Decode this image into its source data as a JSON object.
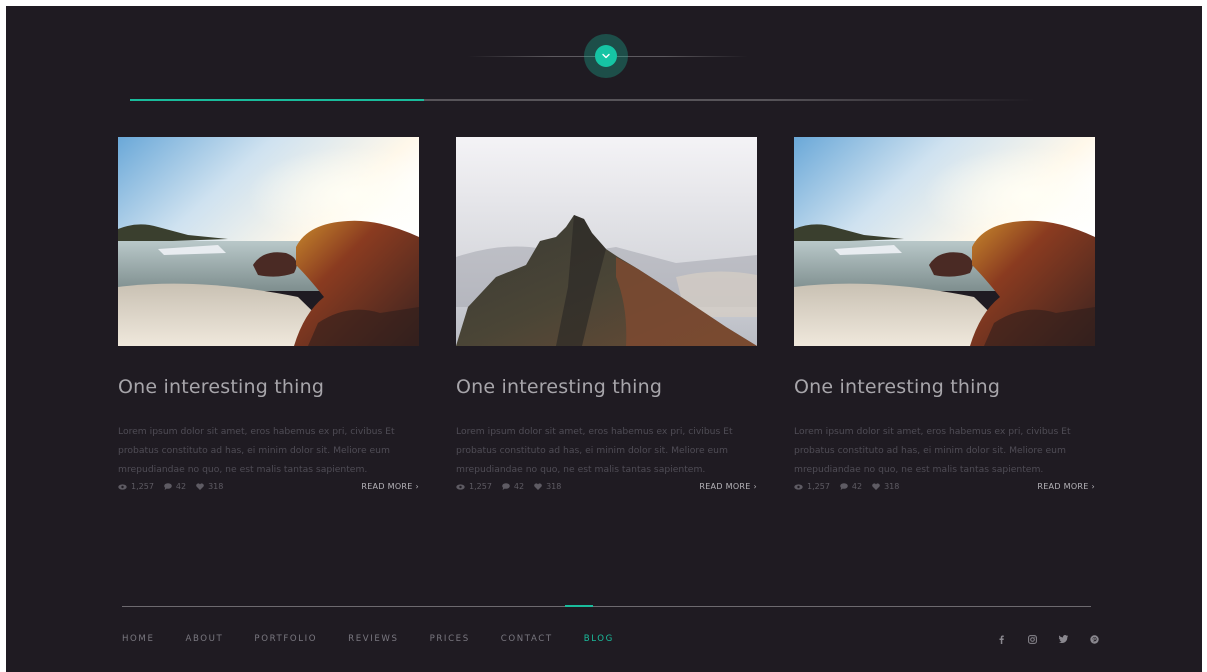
{
  "colors": {
    "background": "#1f1b22",
    "accent": "#1abc9c",
    "title": "#a7a5aa",
    "body_text": "#4f4c55"
  },
  "progress": {
    "fraction": 0.325
  },
  "scroll_button": {
    "icon": "chevron-down-icon"
  },
  "posts": [
    {
      "image": "beach-sunset-image",
      "title": "One interesting thing",
      "excerpt": "Lorem ipsum dolor sit amet, eros habemus ex pri, civibus Et probatus constituto ad has, ei minim dolor sit. Meliore eum mrepudiandae no quo, ne est malis tantas sapientem.",
      "views": "1,257",
      "comments": "42",
      "likes": "318",
      "read_more": "READ MORE ›"
    },
    {
      "image": "mountain-peak-image",
      "title": "One interesting thing",
      "excerpt": "Lorem ipsum dolor sit amet, eros habemus ex pri, civibus Et probatus constituto ad has, ei minim dolor sit. Meliore eum mrepudiandae no quo, ne est malis tantas sapientem.",
      "views": "1,257",
      "comments": "42",
      "likes": "318",
      "read_more": "READ MORE ›"
    },
    {
      "image": "beach-sunset-image",
      "title": "One interesting thing",
      "excerpt": "Lorem ipsum dolor sit amet, eros habemus ex pri, civibus Et probatus constituto ad has, ei minim dolor sit. Meliore eum mrepudiandae no quo, ne est malis tantas sapientem.",
      "views": "1,257",
      "comments": "42",
      "likes": "318",
      "read_more": "READ MORE ›"
    }
  ],
  "footer": {
    "nav": [
      "HOME",
      "ABOUT",
      "PORTFOLIO",
      "REVIEWS",
      "PRICES",
      "CONTACT",
      "BLOG"
    ],
    "active": "BLOG",
    "social": [
      "facebook-icon",
      "instagram-icon",
      "twitter-icon",
      "pinterest-icon"
    ]
  }
}
